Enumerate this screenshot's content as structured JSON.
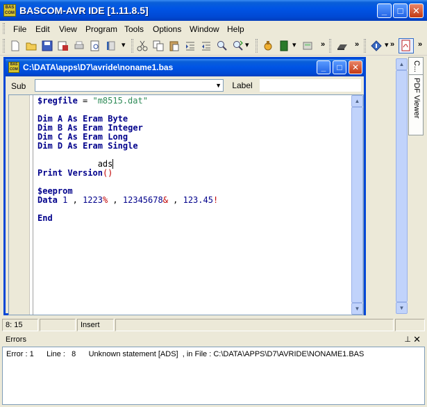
{
  "app": {
    "title": "BASCOM-AVR IDE [1.11.8.5]",
    "icon_text": "BAS COM"
  },
  "window_controls": {
    "minimize": "_",
    "maximize": "□",
    "close": "✕"
  },
  "menu": {
    "items": [
      "File",
      "Edit",
      "View",
      "Program",
      "Tools",
      "Options",
      "Window",
      "Help"
    ]
  },
  "toolbar": {
    "chevron": "»"
  },
  "document": {
    "path": "C:\\DATA\\apps\\D7\\avride\\noname1.bas",
    "sub_label": "Sub",
    "sub_value": "",
    "label_button": "Label",
    "code": {
      "l1_a": "$regfile",
      "l1_b": " = ",
      "l1_c": "\"m8515.dat\"",
      "dim": "Dim",
      "as_": "As",
      "eram": "Eram",
      "a": "A",
      "b": "B",
      "c": "C",
      "d": "D",
      "byte": "Byte",
      "integer": "Integer",
      "long": "Long",
      "single": "Single",
      "ads": "            ads",
      "print": "Print",
      "version": "Version",
      "parens": "()",
      "eeprom": "$eeprom",
      "data": "Data",
      "d1": "1",
      "comma": " , ",
      "d2": "1223",
      "pct": "%",
      "d3": "12345678",
      "amp": "&",
      "d4": "123.45",
      "bang": "!",
      "end": "End"
    }
  },
  "side_tabs": [
    "C...",
    "PDF Viewer"
  ],
  "status": {
    "position": "8: 15",
    "blank": "",
    "mode": "Insert",
    "message": ""
  },
  "errors": {
    "title": "Errors",
    "pin": "⊥",
    "close": "✕",
    "line": "Error : 1      Line :   8      Unknown statement [ADS]  , in File : C:\\DATA\\APPS\\D7\\AVRIDE\\NONAME1.BAS"
  }
}
